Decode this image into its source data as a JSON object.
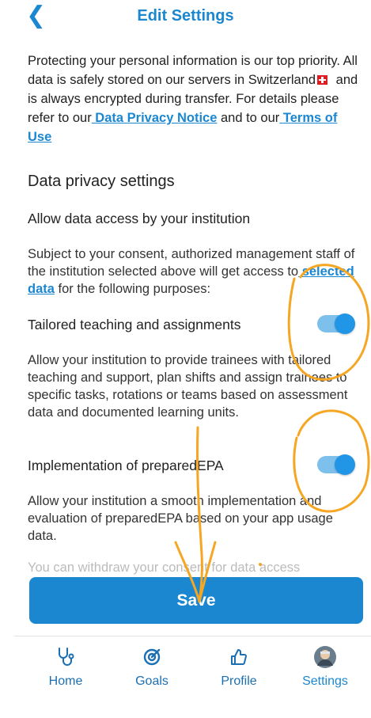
{
  "header": {
    "title": "Edit Settings"
  },
  "intro": {
    "text_before_flag": "Protecting your personal information is our top priority. All data is safely stored on our servers in Switzerland",
    "text_after_flag": " and is always encrypted during transfer. For details please refer to our",
    "privacy_link": " Data Privacy Notice",
    "and_text": " and to our",
    "terms_link": " Terms of Use"
  },
  "privacy": {
    "heading": "Data privacy settings",
    "allow_heading": "Allow data access by your institution",
    "consent_before": "Subject to your consent, authorized management staff of the institution selected above will get access to",
    "consent_link": " selected data",
    "consent_after": " for the following purposes:"
  },
  "tailored": {
    "heading": "Tailored teaching and assignments",
    "enabled": true,
    "description": "Allow your institution to provide trainees with tailored teaching and support, plan shifts and assign trainees to specific tasks, rotations or teams based on assessment data and documented learning units."
  },
  "implementation": {
    "heading": "Implementation of preparedEPA",
    "enabled": true,
    "description": "Allow your institution a smooth implementation and evaluation of preparedEPA based on your app usage data."
  },
  "withdraw_text": "You can withdraw your consent for data access",
  "save_label": "Save",
  "tabs": [
    {
      "label": "Home",
      "icon": "stethoscope-icon"
    },
    {
      "label": "Goals",
      "icon": "target-icon"
    },
    {
      "label": "Profile",
      "icon": "thumbs-up-icon"
    },
    {
      "label": "Settings",
      "icon": "avatar-icon"
    }
  ],
  "colors": {
    "accent": "#1b87d1",
    "toggle_track": "#7ec0ec",
    "annotation": "#f5a623"
  }
}
